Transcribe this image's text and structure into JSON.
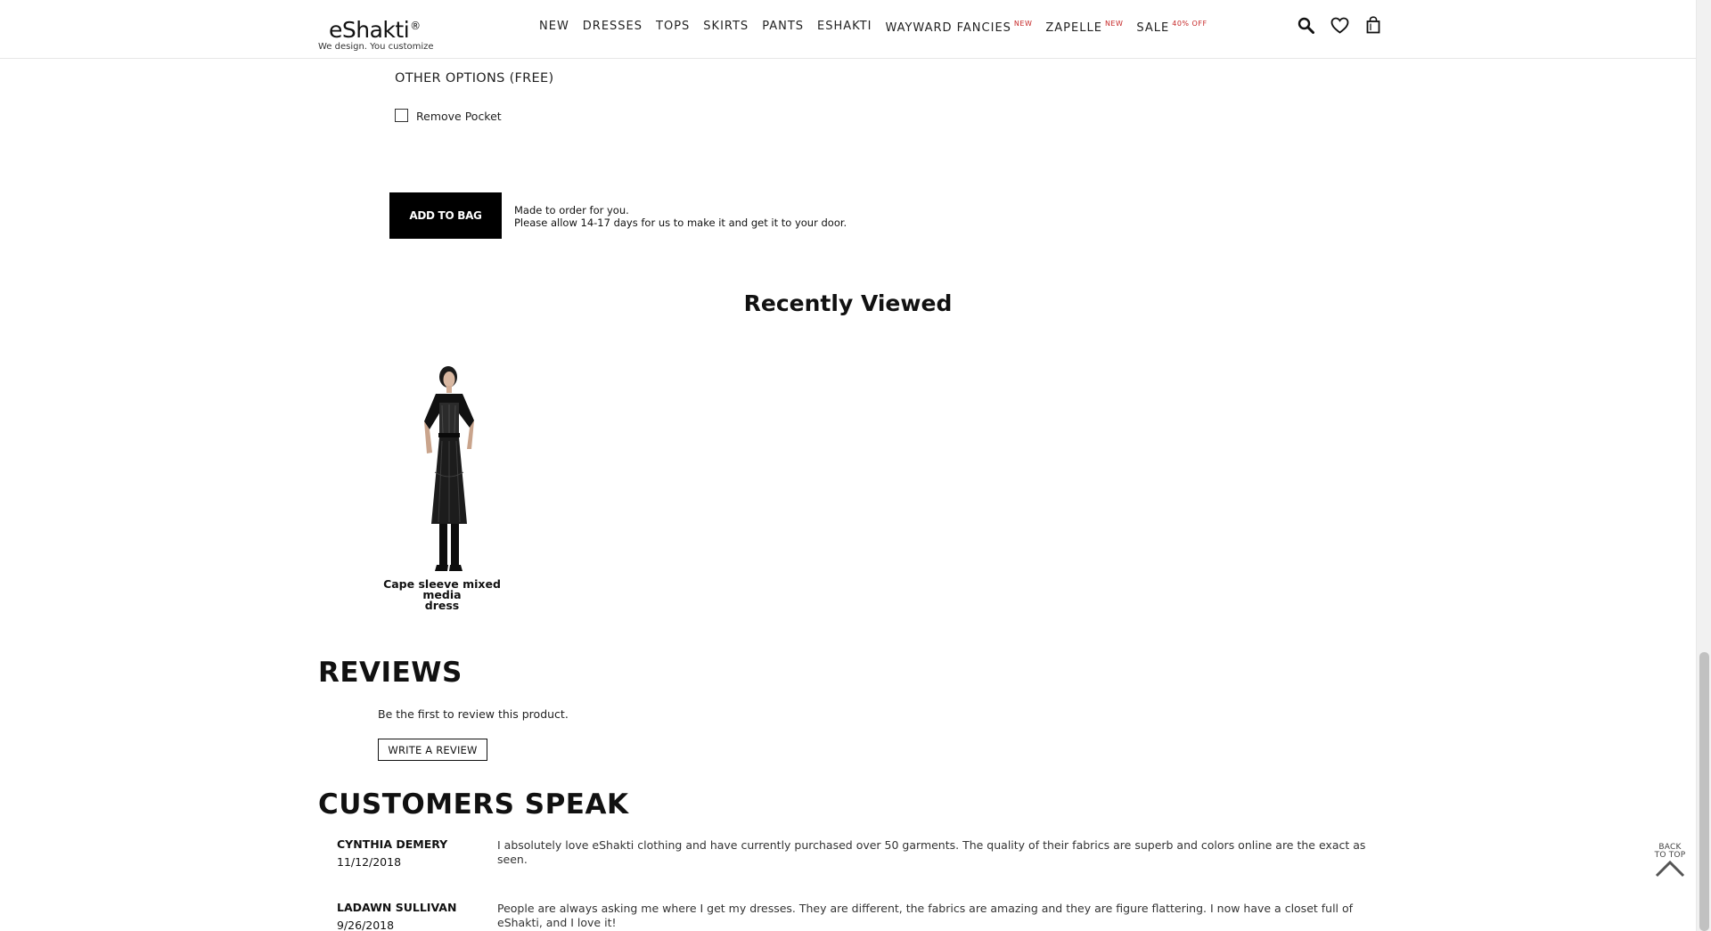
{
  "header": {
    "logo_text": "eShakti",
    "logo_mark": "®",
    "logo_tagline": "We design. You customize",
    "nav": [
      {
        "label": "NEW",
        "badge": ""
      },
      {
        "label": "DRESSES",
        "badge": ""
      },
      {
        "label": "TOPS",
        "badge": ""
      },
      {
        "label": "SKIRTS",
        "badge": ""
      },
      {
        "label": "PANTS",
        "badge": ""
      },
      {
        "label": "ESHAKTI",
        "badge": ""
      },
      {
        "label": "WAYWARD FANCIES",
        "badge": "NEW"
      },
      {
        "label": "ZAPELLE",
        "badge": "NEW"
      },
      {
        "label": "SALE",
        "badge": "40% OFF"
      }
    ],
    "icons": [
      "search-icon",
      "heart-icon",
      "shopping-bag-icon"
    ]
  },
  "options": {
    "title": "OTHER OPTIONS (FREE)",
    "remove_pocket_label": "Remove Pocket",
    "remove_pocket_checked": false
  },
  "cart": {
    "add_to_bag_label": "ADD TO BAG",
    "note_line1": "Made to order for you.",
    "note_line2": "Please allow 14-17 days for us to make it and get it to your door."
  },
  "recently_viewed": {
    "title": "Recently Viewed",
    "products": [
      {
        "name_line1": "Cape sleeve mixed media",
        "name_line2": "dress"
      }
    ]
  },
  "reviews": {
    "title": "REVIEWS",
    "empty_text": "Be the first to review this product.",
    "write_review_label": "WRITE A REVIEW"
  },
  "customers_speak": {
    "title": "CUSTOMERS SPEAK",
    "testimonials": [
      {
        "name": "CYNTHIA DEMERY",
        "date": "11/12/2018",
        "text": "I absolutely love eShakti clothing and have currently purchased over 50 garments. The quality of their fabrics are superb and colors online are the exact as seen."
      },
      {
        "name": "LADAWN SULLIVAN",
        "date": "9/26/2018",
        "text": "People are always asking me where I get my dresses. They are different, the fabrics are amazing and they are figure flattering. I now have a closet full of eShakti, and I love it!"
      }
    ]
  },
  "back_to_top": {
    "line1": "BACK",
    "line2": "TO TOP"
  },
  "colors": {
    "badge": "#c62828",
    "button_bg": "#000000",
    "text": "#111111"
  }
}
